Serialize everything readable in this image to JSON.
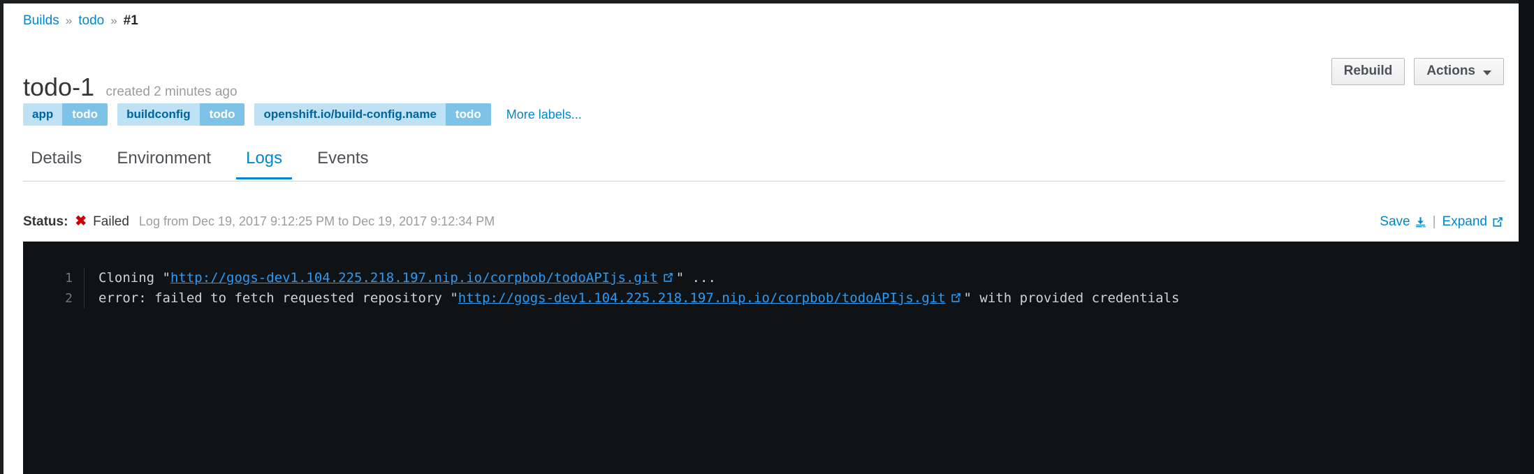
{
  "breadcrumb": {
    "items": [
      {
        "label": "Builds",
        "link": true
      },
      {
        "label": "todo",
        "link": true
      },
      {
        "label": "#1",
        "link": false
      }
    ],
    "separator": "»"
  },
  "header": {
    "title": "todo-1",
    "subtitle": "created 2 minutes ago",
    "rebuild_label": "Rebuild",
    "actions_label": "Actions"
  },
  "labels": {
    "items": [
      {
        "key": "app",
        "value": "todo"
      },
      {
        "key": "buildconfig",
        "value": "todo"
      },
      {
        "key": "openshift.io/build-config.name",
        "value": "todo"
      }
    ],
    "more_label": "More labels..."
  },
  "tabs": {
    "items": [
      {
        "label": "Details",
        "active": false
      },
      {
        "label": "Environment",
        "active": false
      },
      {
        "label": "Logs",
        "active": true
      },
      {
        "label": "Events",
        "active": false
      }
    ]
  },
  "status": {
    "label": "Status:",
    "icon": "times-circle-icon",
    "value": "Failed",
    "range": "Log from Dec 19, 2017 9:12:25 PM to Dec 19, 2017 9:12:34 PM",
    "save_label": "Save",
    "save_icon": "download-icon",
    "divider": "|",
    "expand_label": "Expand",
    "expand_icon": "external-link-icon"
  },
  "log": {
    "lines": [
      {
        "number": "1",
        "segments": [
          {
            "type": "text",
            "text": "Cloning \""
          },
          {
            "type": "link",
            "text": "http://gogs-dev1.104.225.218.197.nip.io/corpbob/todoAPIjs.git"
          },
          {
            "type": "text",
            "text": "\" ..."
          }
        ]
      },
      {
        "number": "2",
        "segments": [
          {
            "type": "text",
            "text": "error: failed to fetch requested repository \""
          },
          {
            "type": "link",
            "text": "http://gogs-dev1.104.225.218.197.nip.io/corpbob/todoAPIjs.git"
          },
          {
            "type": "text",
            "text": "\" with provided credentials"
          }
        ]
      }
    ]
  },
  "colors": {
    "link": "#0088ce",
    "label_key_bg": "#bee1f4",
    "label_key_text": "#00659c",
    "label_value_bg": "#7dc3e8",
    "danger": "#cc0000",
    "log_bg": "#0f1316",
    "log_text": "#d1d1d1",
    "log_link": "#2b9af3"
  }
}
